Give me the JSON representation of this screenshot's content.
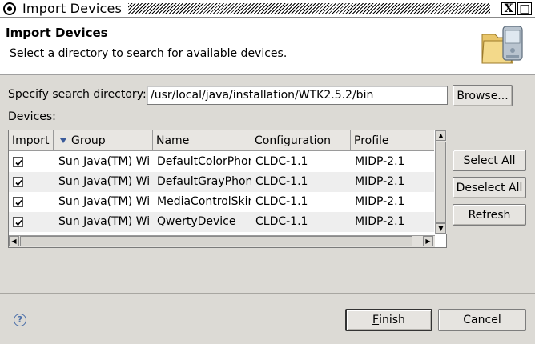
{
  "window": {
    "title": "Import Devices",
    "close_glyph": "X",
    "maximize_glyph": "□"
  },
  "header": {
    "title": "Import Devices",
    "description": "Select a directory to search for available devices.",
    "image_icon": "folder-devices-icon"
  },
  "search": {
    "label": "Specify search directory:",
    "value": "/usr/local/java/installation/WTK2.5.2/bin",
    "browse_label": "Browse..."
  },
  "devices": {
    "label": "Devices:",
    "columns": [
      "Import",
      "Group",
      "Name",
      "Configuration",
      "Profile"
    ],
    "sort_column": "Group",
    "rows": [
      {
        "checked": true,
        "group": "Sun Java(TM) Wireless Toolkit",
        "name": "DefaultColorPhone",
        "configuration": "CLDC-1.1",
        "profile": "MIDP-2.1"
      },
      {
        "checked": true,
        "group": "Sun Java(TM) Wireless Toolkit",
        "name": "DefaultGrayPhone",
        "configuration": "CLDC-1.1",
        "profile": "MIDP-2.1"
      },
      {
        "checked": true,
        "group": "Sun Java(TM) Wireless Toolkit",
        "name": "MediaControlSkin",
        "configuration": "CLDC-1.1",
        "profile": "MIDP-2.1"
      },
      {
        "checked": true,
        "group": "Sun Java(TM) Wireless Toolkit",
        "name": "QwertyDevice",
        "configuration": "CLDC-1.1",
        "profile": "MIDP-2.1"
      }
    ]
  },
  "side_buttons": {
    "select_all": "Select All",
    "deselect_all": "Deselect All",
    "refresh": "Refresh"
  },
  "footer": {
    "help_glyph": "?",
    "finish_mnemonic": "F",
    "finish_rest": "inish",
    "cancel_label": "Cancel"
  }
}
